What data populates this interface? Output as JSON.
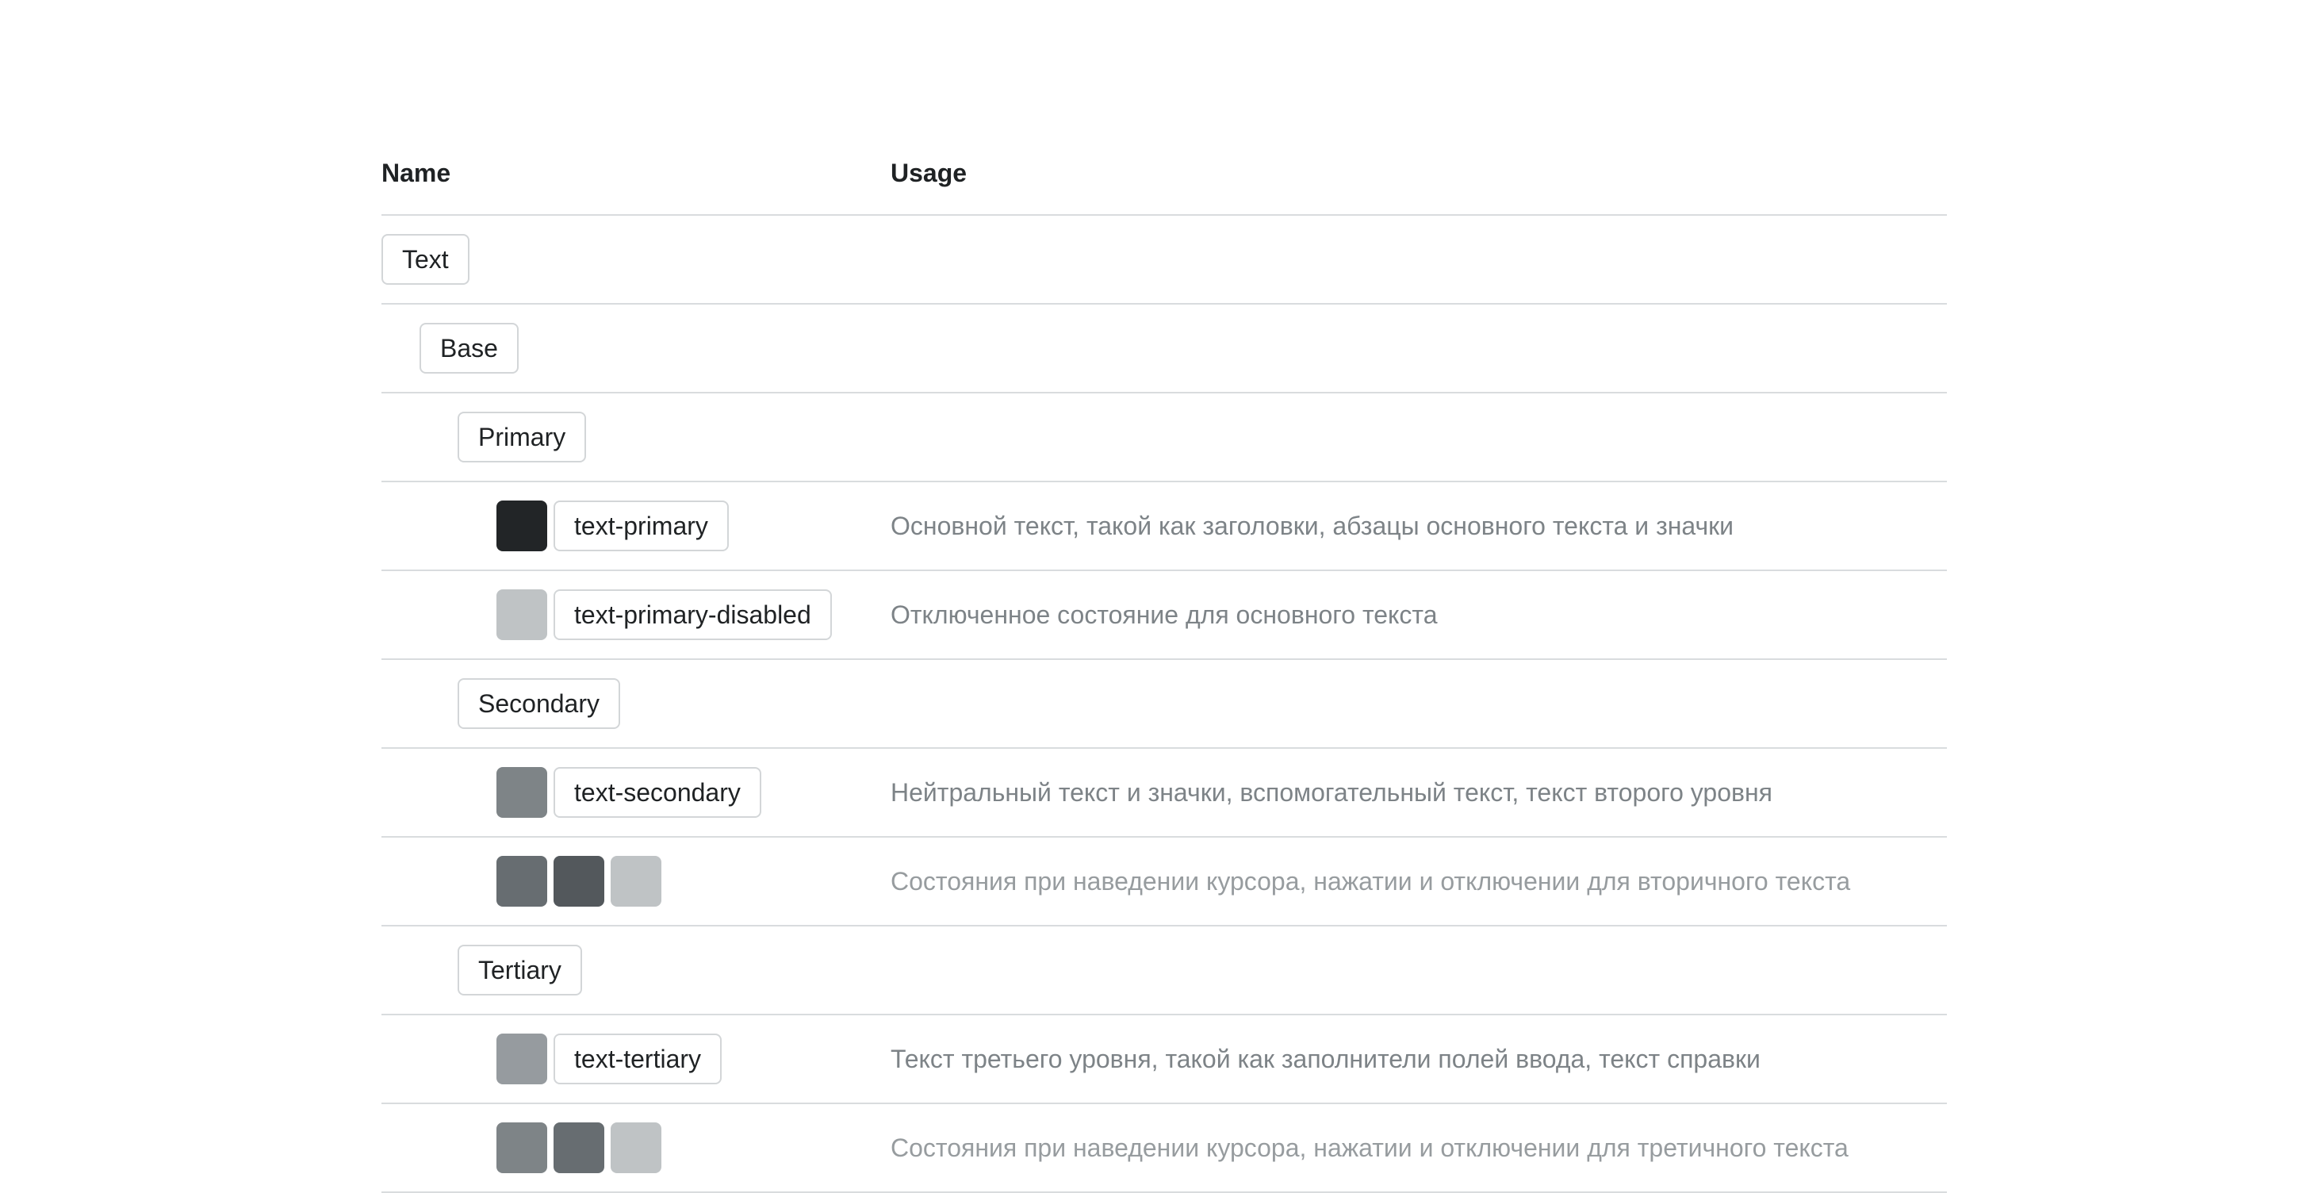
{
  "table": {
    "header": {
      "name": "Name",
      "usage": "Usage"
    },
    "rows": [
      {
        "tag": "Text"
      },
      {
        "tag": "Base"
      },
      {
        "tag": "Primary"
      },
      {
        "tag": "text-primary",
        "usage": "Основной текст, такой как заголовки, абзацы основного текста и значки",
        "swatches": [
          "#222527"
        ]
      },
      {
        "tag": "text-primary-disabled",
        "usage": "Отключенное состояние для основного текста",
        "swatches": [
          "#bfc3c5"
        ]
      },
      {
        "tag": "Secondary"
      },
      {
        "tag": "text-secondary",
        "usage": "Нейтральный текст и значки, вспомогательный текст, текст второго уровня",
        "swatches": [
          "#7e8487"
        ]
      },
      {
        "usage": "Состояния при наведении курсора, нажатии и отключении для вторичного текста",
        "swatches": [
          "#676d71",
          "#53585c",
          "#bfc3c5"
        ]
      },
      {
        "tag": "Tertiary"
      },
      {
        "tag": "text-tertiary",
        "usage": "Текст третьего уровня, такой как заполнители полей ввода, текст справки",
        "swatches": [
          "#969b9f"
        ]
      },
      {
        "usage": "Состояния при наведении курсора, нажатии и отключении для третичного текста",
        "swatches": [
          "#7e8487",
          "#676d71",
          "#bfc3c5"
        ]
      }
    ]
  }
}
